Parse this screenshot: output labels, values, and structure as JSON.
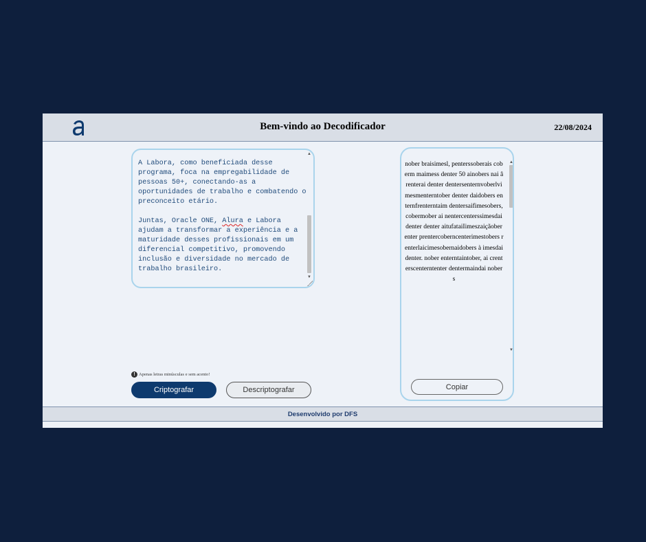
{
  "header": {
    "logo_icon": "alura-a-logo",
    "title": "Bem-vindo ao Decodificador",
    "date": "22/08/2024"
  },
  "input": {
    "paragraph1": "A Labora, como beneficiada desse programa, foca na empregabilidade de pessoas 50+, conectando-as a oportunidades de trabalho e combatendo o preconceito etário.",
    "p2_before": "Juntas, Oracle ONE, ",
    "p2_spell": "Alura",
    "p2_after": " e Labora ajudam a transformar a experiência e a maturidade desses profissionais em um diferencial competitivo, promovendo inclusão e diversidade no mercado de trabalho brasileiro."
  },
  "hint": {
    "icon": "info-icon",
    "text": "Apenas letras minúsculas e sem acento!"
  },
  "buttons": {
    "encrypt": "Criptografar",
    "decrypt": "Descriptografar",
    "copy": "Copiar"
  },
  "output": {
    "text": "nober braisimesl, penterssoberais coberm maimess denter 50 ainobers nai ârenterai denter dentersenternvoberlvimesmenterntober denter daidobers enternfrenterntaim dentersaifimesobers, cobermober ai nentercenterssimesdaidenter denter aitufataiIimeszaiçãober enter prentercoberncenterimestobers renterlaicimesobernaidobers à imesdaidenter. nober enterntaintober, ai crenterscenterntenter dentermaindai nobers"
  },
  "footer": {
    "text": "Desenvolvido por DFS"
  },
  "colors": {
    "page_bg": "#0e1f3d",
    "app_bg": "#eef2f8",
    "header_bg": "#d9dee6",
    "primary": "#0e3a6e",
    "border_accent": "#a9d4ec"
  }
}
